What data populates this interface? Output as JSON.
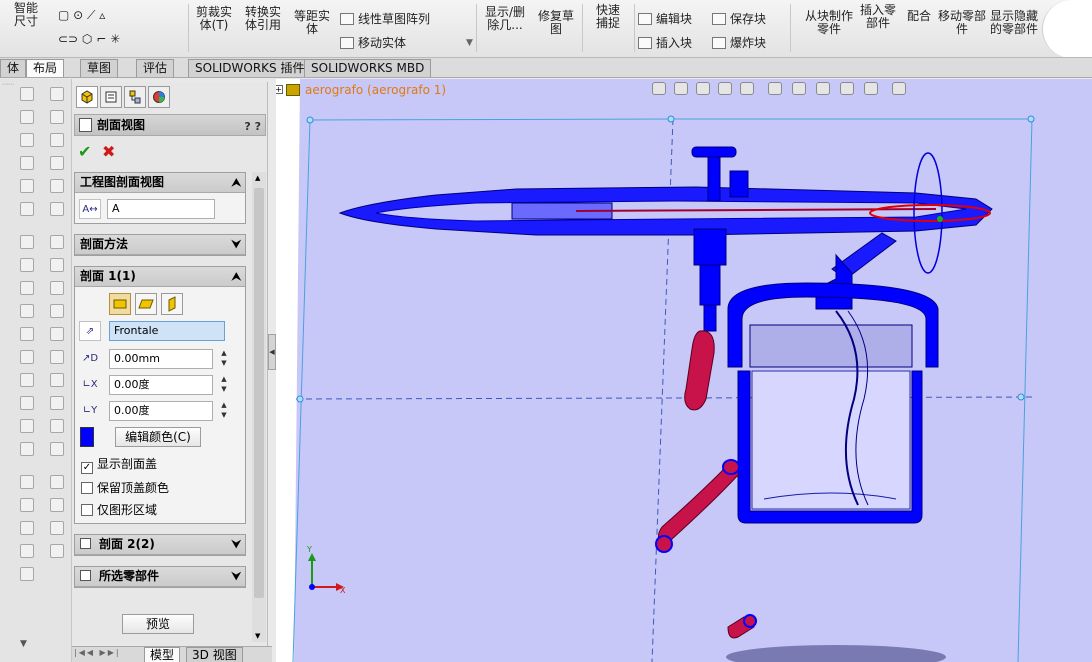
{
  "ribbon": {
    "smart_dim": "智能尺寸",
    "trim": "剪裁实体(T)",
    "convert": "转换实体引用",
    "offset": "等距实体",
    "linear_pattern": "线性草图阵列",
    "move_entities": "移动实体",
    "display_delete": "显示/删除几...",
    "repair_sketch": "修复草图",
    "quick_snap": "快速捕捉",
    "edit_block": "编辑块",
    "save_block": "保存块",
    "insert_block": "插入块",
    "explode_block": "爆炸块",
    "make_part": "从块制作零件",
    "insert_part": "插入零部件",
    "mate": "配合",
    "move_component": "移动零部件",
    "show_hidden": "显示隐藏的零部件"
  },
  "tabs": [
    "体",
    "布局",
    "草图",
    "评估",
    "SOLIDWORKS 插件",
    "SOLIDWORKS MBD"
  ],
  "active_tab": "布局",
  "pm": {
    "title": "剖面视图",
    "help": "? ?",
    "ok": "✔",
    "cancel": "✖",
    "group_drawing": {
      "title": "工程图剖面视图",
      "label_value": "A"
    },
    "group_method": {
      "title": "剖面方法"
    },
    "group_section1": {
      "title": "剖面 1(1)",
      "plane": "Frontale",
      "offset": "0.00mm",
      "angle_x": "0.00度",
      "angle_y": "0.00度",
      "color_hex": "#0000ff",
      "edit_color": "编辑颜色(C)",
      "show_cap": "显示剖面盖",
      "show_cap_checked": true,
      "keep_cap_color": "保留顶盖颜色",
      "keep_cap_color_checked": false,
      "graphics_only": "仅图形区域",
      "graphics_only_checked": false
    },
    "group_section2": {
      "title": "剖面 2(2)"
    },
    "group_components": {
      "title": "所选零部件"
    },
    "preview": "预览"
  },
  "bottom_tabs": [
    "模型",
    "3D 视图"
  ],
  "viewport": {
    "title": "aerografo  (aerografo 1)",
    "plane_color": "#c8c8f8",
    "section_color": "#0000ff",
    "hose_color": "#c8124a",
    "axis_x": "X",
    "axis_y": "Y"
  }
}
